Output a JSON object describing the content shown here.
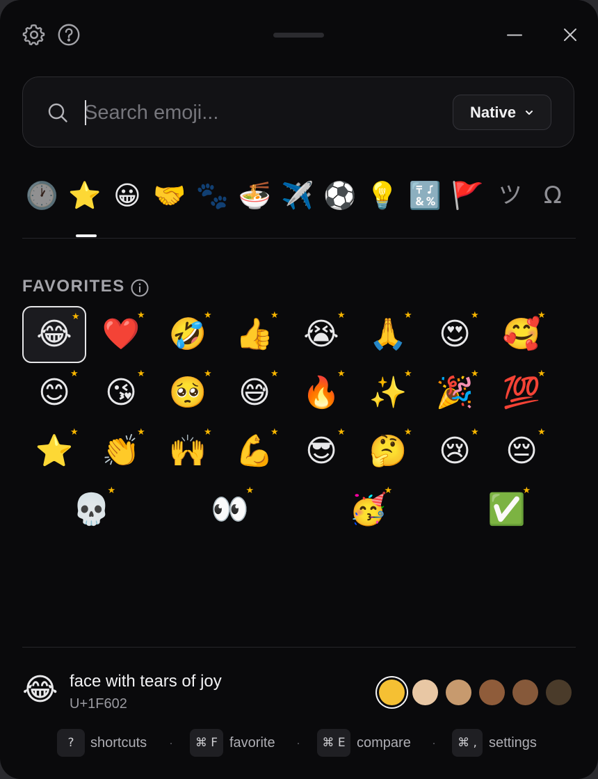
{
  "titlebar": {
    "icons": [
      "gear-icon",
      "question-circle-icon",
      "minimize-icon",
      "close-icon"
    ]
  },
  "search": {
    "placeholder": "Search emoji...",
    "value": "",
    "source_label": "Native"
  },
  "categories": [
    {
      "id": "recent",
      "glyph": "🕐",
      "icon": "clock-icon",
      "active": false
    },
    {
      "id": "favorites",
      "glyph": "⭐",
      "icon": "star-icon",
      "active": true
    },
    {
      "id": "smileys",
      "glyph": "😀",
      "icon": "smiley-icon",
      "active": false
    },
    {
      "id": "people",
      "glyph": "🤝",
      "icon": "handshake-icon",
      "active": false
    },
    {
      "id": "animals",
      "glyph": "🐾",
      "icon": "paw-icon",
      "active": false
    },
    {
      "id": "food",
      "glyph": "🍜",
      "icon": "noodle-bowl-icon",
      "active": false
    },
    {
      "id": "travel",
      "glyph": "✈️",
      "icon": "airplane-icon",
      "active": false
    },
    {
      "id": "activities",
      "glyph": "⚽",
      "icon": "soccer-ball-icon",
      "active": false
    },
    {
      "id": "objects",
      "glyph": "💡",
      "icon": "lightbulb-icon",
      "active": false
    },
    {
      "id": "symbols",
      "glyph": "🔣",
      "icon": "symbols-icon",
      "active": false
    },
    {
      "id": "flags",
      "glyph": "🚩",
      "icon": "flag-icon",
      "active": false
    },
    {
      "id": "kaomoji",
      "glyph": "ツ",
      "icon": "kaomoji-icon",
      "active": false
    },
    {
      "id": "special",
      "glyph": "Ω",
      "icon": "omega-icon",
      "active": false
    }
  ],
  "section": {
    "title": "FAVORITES"
  },
  "favorites": [
    {
      "glyph": "😂",
      "name": "face with tears of joy",
      "selected": true
    },
    {
      "glyph": "❤️",
      "name": "red heart"
    },
    {
      "glyph": "🤣",
      "name": "rolling on the floor laughing"
    },
    {
      "glyph": "👍",
      "name": "thumbs up"
    },
    {
      "glyph": "😭",
      "name": "loudly crying face"
    },
    {
      "glyph": "🙏",
      "name": "folded hands"
    },
    {
      "glyph": "😍",
      "name": "smiling face with heart-eyes"
    },
    {
      "glyph": "🥰",
      "name": "smiling face with hearts"
    },
    {
      "glyph": "😊",
      "name": "smiling face with smiling eyes"
    },
    {
      "glyph": "😘",
      "name": "face blowing a kiss"
    },
    {
      "glyph": "🥺",
      "name": "pleading face"
    },
    {
      "glyph": "😅",
      "name": "grinning face with sweat"
    },
    {
      "glyph": "🔥",
      "name": "fire"
    },
    {
      "glyph": "✨",
      "name": "sparkles"
    },
    {
      "glyph": "🎉",
      "name": "party popper"
    },
    {
      "glyph": "💯",
      "name": "hundred points"
    },
    {
      "glyph": "⭐",
      "name": "star"
    },
    {
      "glyph": "👏",
      "name": "clapping hands"
    },
    {
      "glyph": "🙌",
      "name": "raising hands"
    },
    {
      "glyph": "💪",
      "name": "flexed biceps"
    },
    {
      "glyph": "😎",
      "name": "smiling face with sunglasses"
    },
    {
      "glyph": "🤔",
      "name": "thinking face"
    },
    {
      "glyph": "😢",
      "name": "crying face"
    },
    {
      "glyph": "😔",
      "name": "pensive face"
    },
    {
      "glyph": "💀",
      "name": "skull"
    },
    {
      "glyph": "👀",
      "name": "eyes"
    },
    {
      "glyph": "🥳",
      "name": "partying face"
    },
    {
      "glyph": "✅",
      "name": "check mark button"
    }
  ],
  "preview": {
    "glyph": "😂",
    "name": "face with tears of joy",
    "code": "U+1F602"
  },
  "skin_tones": [
    {
      "color": "#f5c033",
      "selected": true
    },
    {
      "color": "#e8c7a4",
      "selected": false
    },
    {
      "color": "#c79a6e",
      "selected": false
    },
    {
      "color": "#8f5c3a",
      "selected": false
    },
    {
      "color": "#86593a",
      "selected": false
    },
    {
      "color": "#4a3b2a",
      "selected": false
    }
  ],
  "shortcuts": [
    {
      "key": "?",
      "label": "shortcuts"
    },
    {
      "key": "⌘ F",
      "label": "favorite"
    },
    {
      "key": "⌘ E",
      "label": "compare"
    },
    {
      "key": "⌘ ,",
      "label": "settings"
    }
  ],
  "shortcut_separator": "·",
  "colors": {
    "background": "#0a0a0c",
    "favorite_star": "#f7b500",
    "accent_text": "#f2f2f4"
  }
}
